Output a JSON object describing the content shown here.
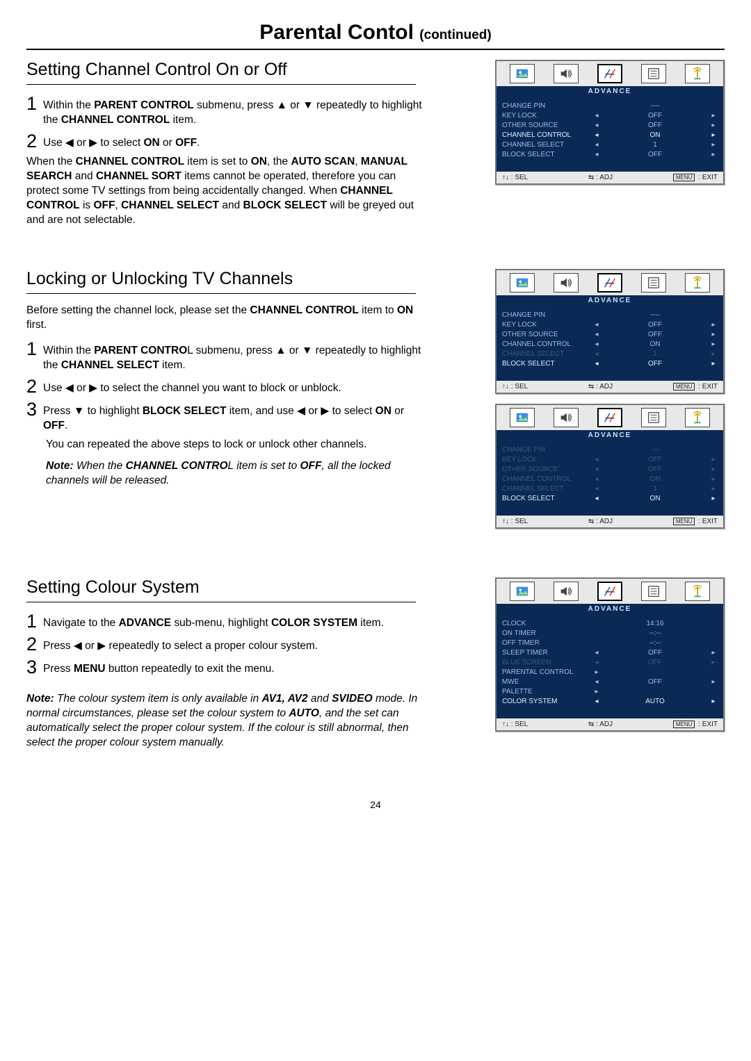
{
  "page": {
    "title": "Parental Contol",
    "title_suffix": "(continued)",
    "number": "24"
  },
  "arrows": {
    "up": "▲",
    "down": "▼",
    "left": "◀",
    "right": "▶"
  },
  "s1": {
    "title": "Setting Channel Control On or Off",
    "step1_a": "Within the ",
    "step1_b": "PARENT CONTROL",
    "step1_c": " submenu, press ▲ or ▼ repeatedly to highlight the ",
    "step1_d": "CHANNEL CONTROL",
    "step1_e": " item.",
    "step2_a": "Use ◀ or ▶ to select ",
    "step2_on": "ON",
    "step2_or": " or ",
    "step2_off": "OFF",
    "step2_end": ".",
    "para1_a": "When the ",
    "para1_b": "CHANNEL CONTROL",
    "para1_c": " item is set to ",
    "para1_d": "ON",
    "para1_e": ", the ",
    "para1_f": "AUTO SCAN",
    "para1_g": ", ",
    "para1_h": "MANUAL SEARCH",
    "para1_i": " and ",
    "para1_j": "CHANNEL SORT",
    "para1_k": " items cannot be operated, therefore you can protect some TV settings from being accidentally changed. When ",
    "para1_l": "CHANNEL CONTROL",
    "para1_m": " is ",
    "para1_n": "OFF",
    "para1_o": ", ",
    "para1_p": "CHANNEL SELECT",
    "para1_q": " and ",
    "para1_r": "BLOCK SELECT",
    "para1_s": " will be greyed out and are not selectable."
  },
  "s2": {
    "title": "Locking or Unlocking TV Channels",
    "intro_a": "Before setting the channel lock, please set the ",
    "intro_b": "CHANNEL CONTROL",
    "intro_c": " item to ",
    "intro_d": "ON",
    "intro_e": " first.",
    "step1_a": "Within the ",
    "step1_b": "PARENT CONTRO",
    "step1_c": "L submenu, press ▲ or ▼ repeatedly to highlight the ",
    "step1_d": "CHANNEL SELECT",
    "step1_e": " item.",
    "step2": "Use ◀ or ▶ to select the channel you want to block or unblock.",
    "step3_a": "Press ▼ to highlight ",
    "step3_b": "BLOCK SELECT",
    "step3_c": " item, and  use ◀ or  ▶ to select ",
    "step3_on": "ON",
    "step3_or": " or ",
    "step3_off": "OFF",
    "step3_end": ".",
    "para1": "You can repeated the above steps to lock or unlock other channels.",
    "note_label": "Note:",
    "note_a": " When the ",
    "note_b": "CHANNEL CONTRO",
    "note_c": "L item is set to ",
    "note_d": "OFF",
    "note_e": ", all the locked channels will be released."
  },
  "s3": {
    "title": "Setting Colour System",
    "step1_a": "Navigate to the ",
    "step1_b": "ADVANCE",
    "step1_c": " sub-menu, highlight ",
    "step1_d": "COLOR SYSTEM",
    "step1_e": " item.",
    "step2": "Press ◀ or ▶ repeatedly to select a proper colour system.",
    "step3_a": "Press ",
    "step3_b": "MENU",
    "step3_c": " button repeatedly to exit the menu.",
    "note_label": "Note:",
    "note_a": " The colour system item is only available in ",
    "note_b": "AV1, AV2",
    "note_c": " and ",
    "note_d": "SVIDEO",
    "note_e": " mode. In normal circumstances, please set the colour system to ",
    "note_f": "AUTO",
    "note_g": ", and the set can automatically select the proper colour system. If the colour is still abnormal, then select the proper colour system manually."
  },
  "osd": {
    "banner": "ADVANCE",
    "footer_sel": "↑↓ :  SEL",
    "footer_adj": "⇆ : ADJ",
    "footer_menu_key": "MENU",
    "footer_exit": ":  EXIT",
    "menu1": {
      "rows": [
        {
          "label": "CHANGE PIN",
          "left": "",
          "val": "----",
          "right": "",
          "style": ""
        },
        {
          "label": "KEY LOCK",
          "left": "◂",
          "val": "OFF",
          "right": "▸",
          "style": ""
        },
        {
          "label": "OTHER SOURCE",
          "left": "◂",
          "val": "OFF",
          "right": "▸",
          "style": ""
        },
        {
          "label": "CHANNEL CONTROL",
          "left": "◂",
          "val": "ON",
          "right": "▸",
          "style": "highlight"
        },
        {
          "label": "CHANNEL SELECT",
          "left": "◂",
          "val": "1",
          "right": "▸",
          "style": ""
        },
        {
          "label": "BLOCK SELECT",
          "left": "◂",
          "val": "OFF",
          "right": "▸",
          "style": ""
        }
      ]
    },
    "menu2": {
      "rows": [
        {
          "label": "CHANGE PIN",
          "left": "",
          "val": "----",
          "right": "",
          "style": ""
        },
        {
          "label": "KEY LOCK",
          "left": "◂",
          "val": "OFF",
          "right": "▸",
          "style": ""
        },
        {
          "label": "OTHER SOURCE",
          "left": "◂",
          "val": "OFF",
          "right": "▸",
          "style": ""
        },
        {
          "label": "CHANNEL CONTROL",
          "left": "◂",
          "val": "ON",
          "right": "▸",
          "style": ""
        },
        {
          "label": "CHANNEL SELECT",
          "left": "◂",
          "val": "1",
          "right": "▸",
          "style": "greyed"
        },
        {
          "label": "BLOCK SELECT",
          "left": "◂",
          "val": "OFF",
          "right": "▸",
          "style": "highlight"
        }
      ]
    },
    "menu3": {
      "rows": [
        {
          "label": "CHANGE PIN",
          "left": "",
          "val": "----",
          "right": "",
          "style": "greyed"
        },
        {
          "label": "KEY LOCK",
          "left": "◂",
          "val": "OFF",
          "right": "▸",
          "style": "greyed"
        },
        {
          "label": "OTHER SOURCE",
          "left": "◂",
          "val": "OFF",
          "right": "▸",
          "style": "greyed"
        },
        {
          "label": "CHANNEL CONTROL",
          "left": "◂",
          "val": "ON",
          "right": "▸",
          "style": "greyed"
        },
        {
          "label": "CHANNEL SELECT",
          "left": "◂",
          "val": "1",
          "right": "▸",
          "style": "greyed"
        },
        {
          "label": "BLOCK SELECT",
          "left": "◂",
          "val": "ON",
          "right": "▸",
          "style": "highlight"
        }
      ]
    },
    "menu4": {
      "rows": [
        {
          "label": "CLOCK",
          "left": "",
          "val": "14:16",
          "right": "",
          "style": ""
        },
        {
          "label": "ON TIMER",
          "left": "",
          "val": "--:--",
          "right": "",
          "style": ""
        },
        {
          "label": "OFF TIMER",
          "left": "",
          "val": "--:--",
          "right": "",
          "style": ""
        },
        {
          "label": "SLEEP TIMER",
          "left": "◂",
          "val": "OFF",
          "right": "▸",
          "style": ""
        },
        {
          "label": "BLUE SCREEN",
          "left": "◂",
          "val": "OFF",
          "right": "▸",
          "style": "greyed"
        },
        {
          "label": "PARENTAL CONTROL",
          "left": "▸",
          "val": "",
          "right": "",
          "style": ""
        },
        {
          "label": "MWE",
          "left": "◂",
          "val": "OFF",
          "right": "▸",
          "style": ""
        },
        {
          "label": "PALETTE",
          "left": "▸",
          "val": "",
          "right": "",
          "style": ""
        },
        {
          "label": "COLOR SYSTEM",
          "left": "◂",
          "val": "AUTO",
          "right": "▸",
          "style": "highlight"
        }
      ]
    }
  }
}
